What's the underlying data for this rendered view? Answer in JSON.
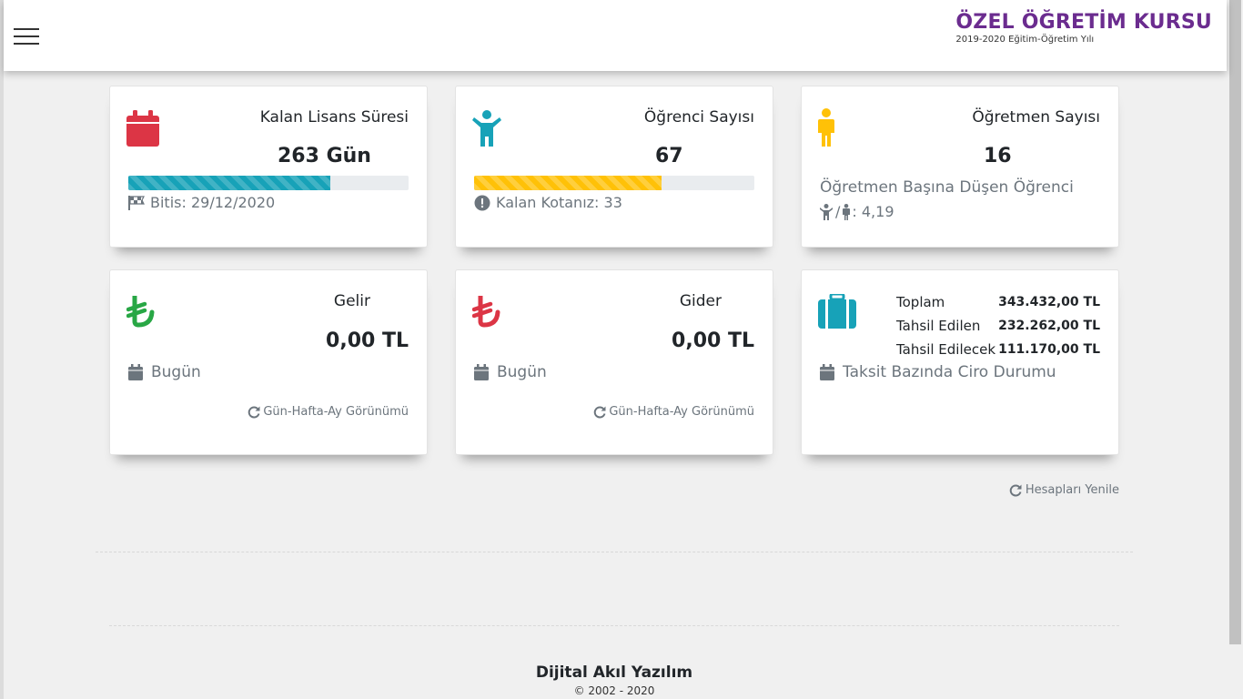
{
  "header": {
    "title": "ÖZEL ÖĞRETİM KURSU",
    "subtitle": "2019-2020 Eğitim-Öğretim Yılı"
  },
  "cards": {
    "license": {
      "label": "Kalan Lisans Süresi",
      "value": "263 Gün",
      "progress_percent": 72,
      "end_text": "Bitis: 29/12/2020",
      "color": "#17a2b8",
      "icon": "calendar-icon"
    },
    "students": {
      "label": "Öğrenci Sayısı",
      "value": "67",
      "progress_percent": 67,
      "quota_text": "Kalan Kotanız: 33",
      "color": "#ffc107",
      "icon": "child-icon"
    },
    "teachers": {
      "label": "Öğretmen Sayısı",
      "value": "16",
      "ratio_label": "Öğretmen Başına Düşen Öğrenci",
      "ratio_value": ": 4,19",
      "color": "#ffc107",
      "icon": "male-icon"
    },
    "income": {
      "label": "Gelir",
      "value": "0,00 TL",
      "period": "Bugün",
      "view_link": "Gün-Hafta-Ay Görünümü",
      "color": "#28a745",
      "icon": "lira-icon"
    },
    "expense": {
      "label": "Gider",
      "value": "0,00 TL",
      "period": "Bugün",
      "view_link": "Gün-Hafta-Ay Görünümü",
      "color": "#dc3545",
      "icon": "lira-icon"
    },
    "turnover": {
      "rows": [
        {
          "label": "Toplam",
          "value": "343.432,00 TL"
        },
        {
          "label": "Tahsil Edilen",
          "value": "232.262,00 TL"
        },
        {
          "label": "Tahsil Edilecek",
          "value": "111.170,00 TL"
        }
      ],
      "caption": "Taksit Bazında Ciro Durumu",
      "color": "#17a2b8",
      "icon": "suitcase-icon"
    }
  },
  "refresh_label": "Hesapları Yenile",
  "footer": {
    "company": "Dijital Akıl Yazılım",
    "copyright": "© 2002 - 2020"
  }
}
